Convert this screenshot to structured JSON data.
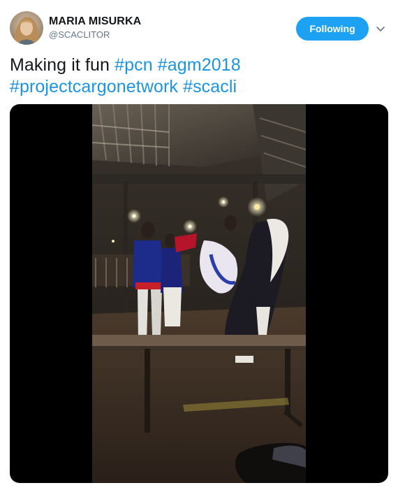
{
  "tweet": {
    "author": {
      "display_name": "MARIA MISURKA",
      "handle": "@SCACLITOR",
      "avatar_icon": "profile-photo-avatar"
    },
    "follow_button_label": "Following",
    "menu_icon": "chevron-down-icon",
    "text": {
      "plain": "Making it fun ",
      "hashtags": [
        "#pcn",
        "#agm2018",
        "#projectcargonetwork",
        "#scacli"
      ]
    },
    "media": {
      "type": "video",
      "description_icon": "video-still"
    }
  },
  "colors": {
    "accent": "#1da1f2",
    "link": "#1b95e0",
    "text": "#14171a",
    "secondary_text": "#657786",
    "media_background": "#000000"
  }
}
